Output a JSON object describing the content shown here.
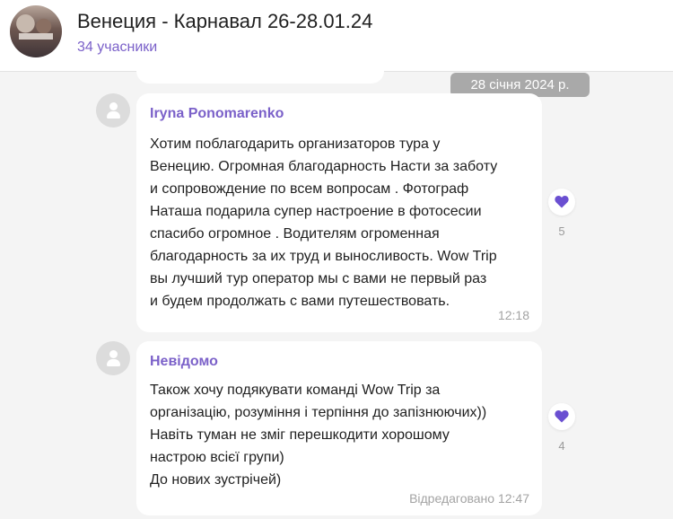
{
  "header": {
    "title": "Венеция - Карнавал 26-28.01.24",
    "members": "34 учасники"
  },
  "date_chip": "28 січня 2024 р.",
  "colors": {
    "accent": "#7b61c9",
    "heart": "#6a4fd1",
    "background": "#f4f4f4"
  },
  "messages": [
    {
      "author": "Iryna Ponomarenko",
      "text": "Хотим поблагодарить организаторов тура у\nВенецию. Огромная благодарность Насти за заботу\nи сопровождение по всем вопросам . Фотограф\nНаташа подарила супер настроение в фотосесии\nспасибо огромное . Водителям  огроменная\nблагодарность за их труд и выносливость. Wow Trip\nвы лучший тур оператор мы с вами не первый раз\nи будем продолжать с вами путешествовать.",
      "time": "12:18",
      "reaction": {
        "icon": "heart-icon",
        "count": "5"
      }
    },
    {
      "author": "Невідомо",
      "text": "Також хочу подякувати команді Wow Trip за\nорганізацію, розуміння і терпіння до запізнюючих))\nНавіть туман не зміг перешкодити хорошому\nнастрою всієї групи)\nДо нових зустрічей)",
      "time": "Відредаговано 12:47",
      "reaction": {
        "icon": "heart-icon",
        "count": "4"
      }
    }
  ]
}
